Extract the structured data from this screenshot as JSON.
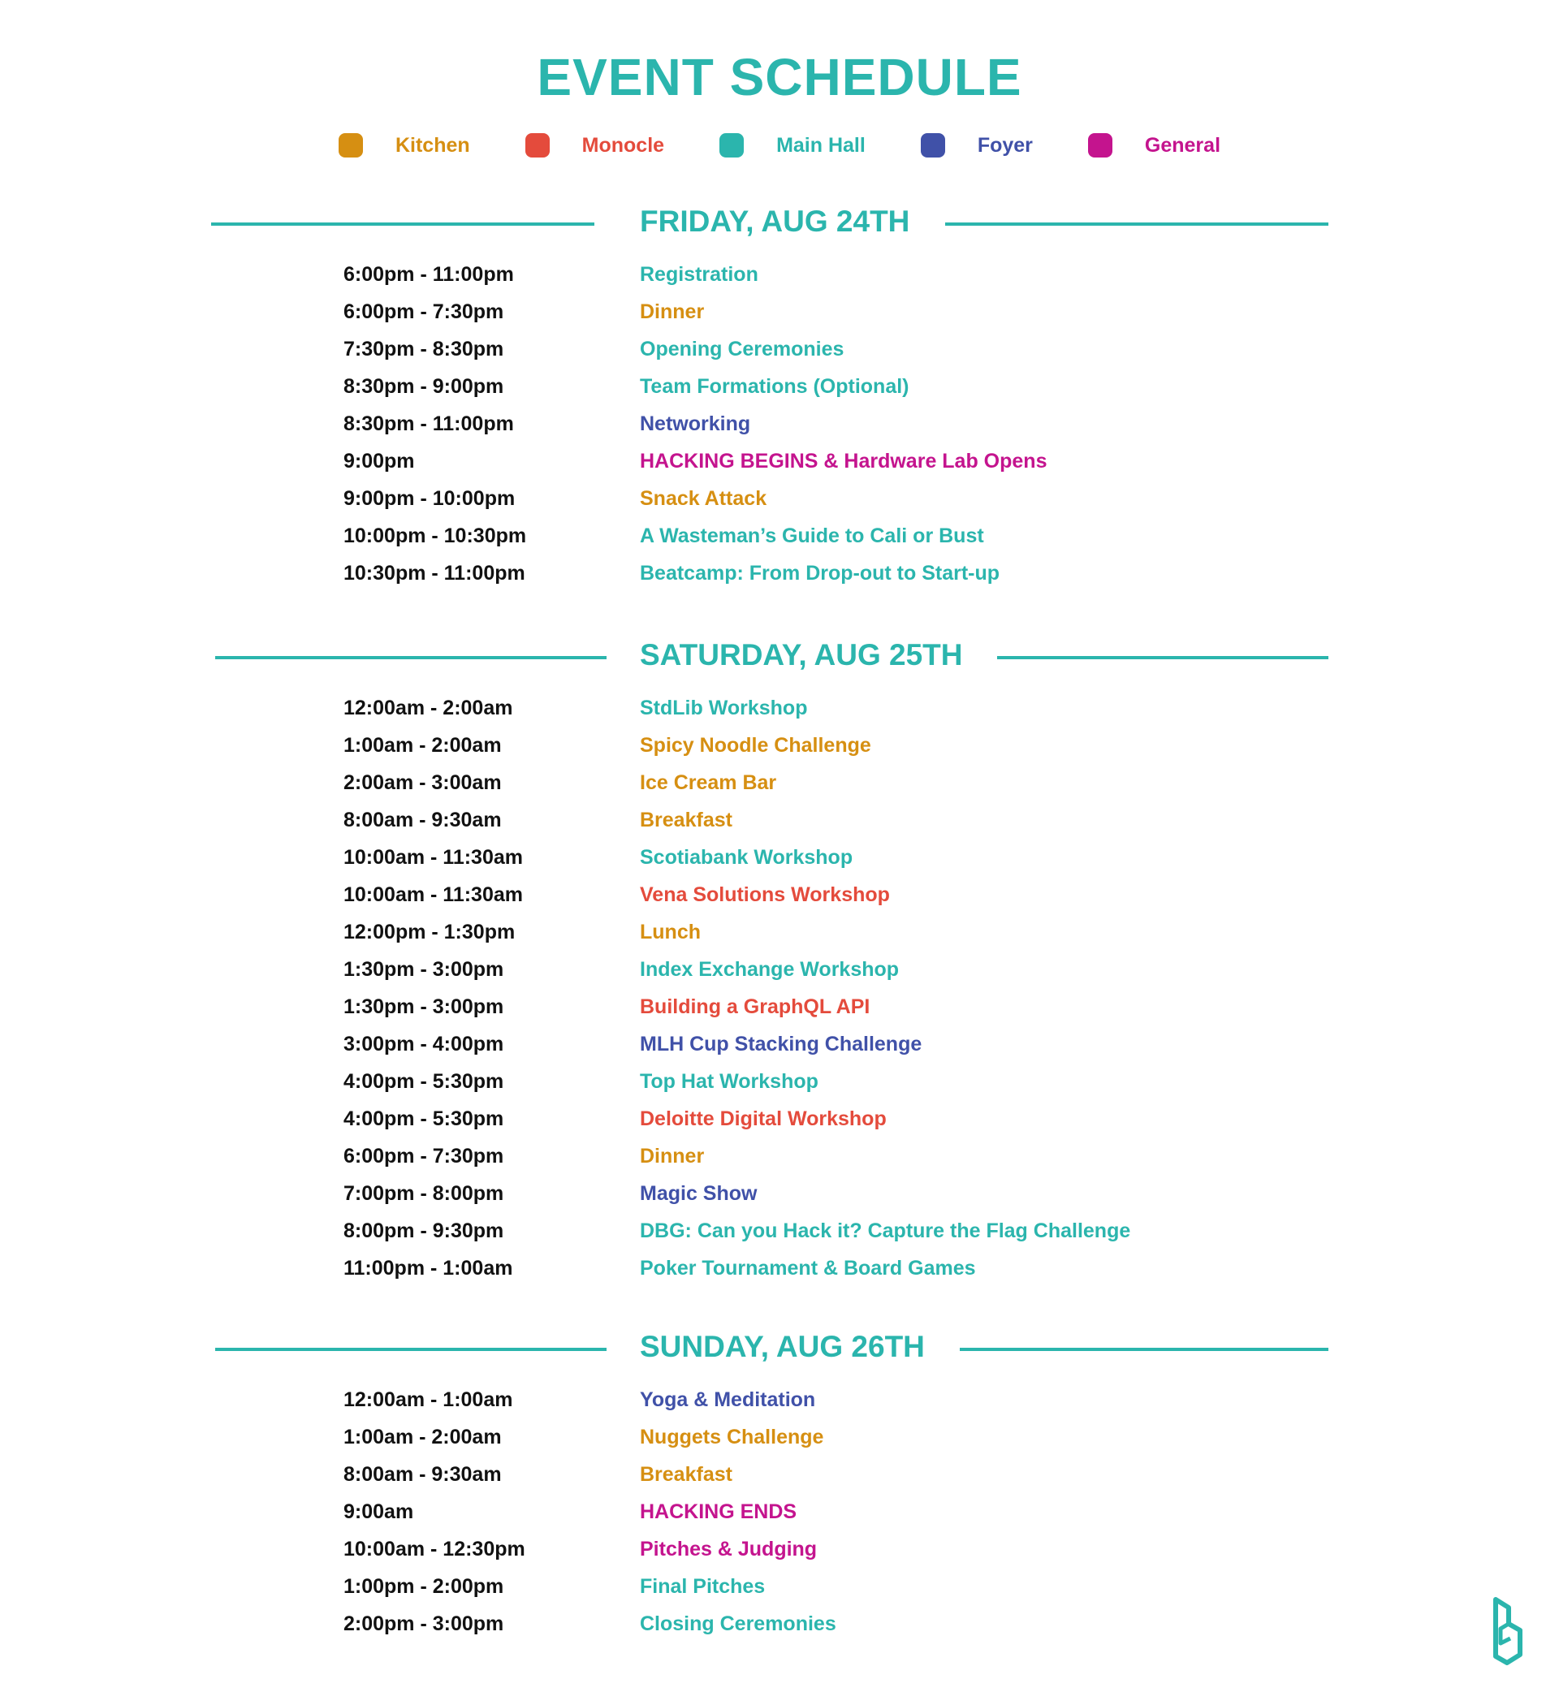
{
  "title": "EVENT SCHEDULE",
  "colors": {
    "teal": "#2bb5ad",
    "kitchen": "#d68f12",
    "monocle": "#e44b3c",
    "main_hall": "#2bb5ad",
    "foyer": "#4051a8",
    "general": "#c4148e",
    "time_text": "#111111"
  },
  "legend": [
    {
      "label": "Kitchen",
      "color": "#d68f12"
    },
    {
      "label": "Monocle",
      "color": "#e44b3c"
    },
    {
      "label": "Main Hall",
      "color": "#2bb5ad"
    },
    {
      "label": "Foyer",
      "color": "#4051a8"
    },
    {
      "label": "General",
      "color": "#c4148e"
    }
  ],
  "days": [
    {
      "title": "FRIDAY, AUG 24TH",
      "events": [
        {
          "time": "6:00pm - 11:00pm",
          "name": "Registration",
          "location": "Main Hall"
        },
        {
          "time": "6:00pm - 7:30pm",
          "name": "Dinner",
          "location": "Kitchen"
        },
        {
          "time": "7:30pm - 8:30pm",
          "name": "Opening Ceremonies",
          "location": "Main Hall"
        },
        {
          "time": "8:30pm - 9:00pm",
          "name": "Team Formations (Optional)",
          "location": "Main Hall"
        },
        {
          "time": "8:30pm - 11:00pm",
          "name": "Networking",
          "location": "Foyer"
        },
        {
          "time": "9:00pm",
          "name": "HACKING BEGINS & Hardware Lab Opens",
          "location": "General"
        },
        {
          "time": "9:00pm - 10:00pm",
          "name": "Snack Attack",
          "location": "Kitchen"
        },
        {
          "time": "10:00pm - 10:30pm",
          "name": "A Wasteman’s Guide to Cali or Bust",
          "location": "Main Hall"
        },
        {
          "time": "10:30pm - 11:00pm",
          "name": "Beatcamp: From Drop-out to Start-up",
          "location": "Main Hall"
        }
      ]
    },
    {
      "title": "SATURDAY, AUG 25TH",
      "events": [
        {
          "time": "12:00am - 2:00am",
          "name": "StdLib Workshop",
          "location": "Main Hall"
        },
        {
          "time": "1:00am - 2:00am",
          "name": "Spicy Noodle Challenge",
          "location": "Kitchen"
        },
        {
          "time": "2:00am - 3:00am",
          "name": "Ice Cream Bar",
          "location": "Kitchen"
        },
        {
          "time": "8:00am - 9:30am",
          "name": "Breakfast",
          "location": "Kitchen"
        },
        {
          "time": "10:00am - 11:30am",
          "name": "Scotiabank Workshop",
          "location": "Main Hall"
        },
        {
          "time": "10:00am - 11:30am",
          "name": "Vena Solutions Workshop",
          "location": "Monocle"
        },
        {
          "time": "12:00pm - 1:30pm",
          "name": "Lunch",
          "location": "Kitchen"
        },
        {
          "time": "1:30pm - 3:00pm",
          "name": "Index Exchange Workshop",
          "location": "Main Hall"
        },
        {
          "time": "1:30pm - 3:00pm",
          "name": "Building a GraphQL API",
          "location": "Monocle"
        },
        {
          "time": "3:00pm - 4:00pm",
          "name": "MLH Cup Stacking Challenge",
          "location": "Foyer"
        },
        {
          "time": "4:00pm - 5:30pm",
          "name": "Top Hat Workshop",
          "location": "Main Hall"
        },
        {
          "time": "4:00pm - 5:30pm",
          "name": "Deloitte Digital Workshop",
          "location": "Monocle"
        },
        {
          "time": "6:00pm - 7:30pm",
          "name": "Dinner",
          "location": "Kitchen"
        },
        {
          "time": "7:00pm - 8:00pm",
          "name": "Magic Show",
          "location": "Foyer"
        },
        {
          "time": "8:00pm - 9:30pm",
          "name": "DBG: Can you Hack it? Capture the Flag Challenge",
          "location": "Main Hall"
        },
        {
          "time": "11:00pm - 1:00am",
          "name": "Poker Tournament & Board Games",
          "location": "Main Hall"
        }
      ]
    },
    {
      "title": "SUNDAY, AUG 26TH",
      "events": [
        {
          "time": "12:00am - 1:00am",
          "name": "Yoga & Meditation",
          "location": "Foyer"
        },
        {
          "time": "1:00am - 2:00am",
          "name": "Nuggets Challenge",
          "location": "Kitchen"
        },
        {
          "time": "8:00am - 9:30am",
          "name": "Breakfast",
          "location": "Kitchen"
        },
        {
          "time": "9:00am",
          "name": "HACKING ENDS",
          "location": "General"
        },
        {
          "time": "10:00am - 12:30pm",
          "name": "Pitches & Judging",
          "location": "General"
        },
        {
          "time": "1:00pm - 2:00pm",
          "name": "Final Pitches",
          "location": "Main Hall"
        },
        {
          "time": "2:00pm - 3:00pm",
          "name": "Closing Ceremonies",
          "location": "Main Hall"
        }
      ]
    }
  ],
  "logo_icon": "hackathon-b-logo-icon"
}
